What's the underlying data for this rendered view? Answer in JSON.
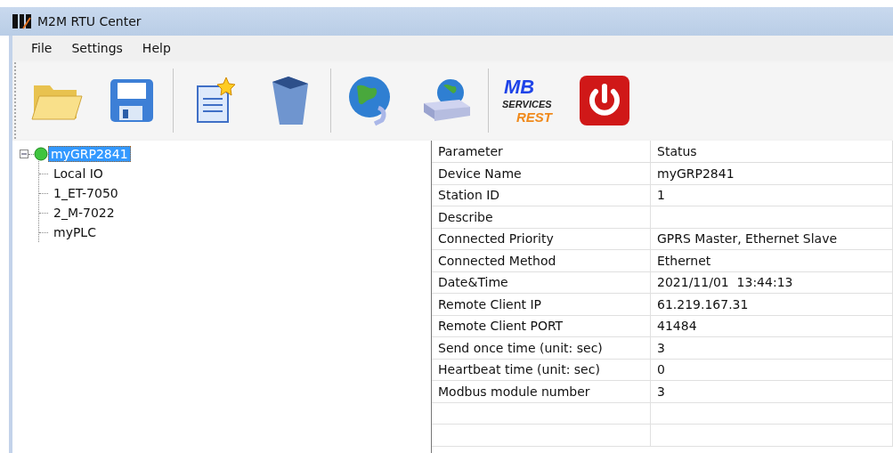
{
  "window": {
    "title": "M2M RTU Center"
  },
  "menu": [
    "File",
    "Settings",
    "Help"
  ],
  "toolbar": [
    {
      "kind": "folder"
    },
    {
      "kind": "floppy"
    },
    {
      "kind": "separator"
    },
    {
      "kind": "document"
    },
    {
      "kind": "bin"
    },
    {
      "kind": "separator"
    },
    {
      "kind": "globe"
    },
    {
      "kind": "server"
    },
    {
      "kind": "separator"
    },
    {
      "kind": "mb",
      "lines": [
        "MB",
        "SERVICES",
        "REST"
      ]
    },
    {
      "kind": "power"
    }
  ],
  "tree": {
    "label": "myGRP2841",
    "selected": true,
    "expanded": true,
    "online": true,
    "children": [
      {
        "label": "Local IO",
        "selected": false
      },
      {
        "label": "1_ET-7050",
        "selected": false
      },
      {
        "label": "2_M-7022",
        "selected": false
      },
      {
        "label": "myPLC",
        "selected": false
      }
    ]
  },
  "table": {
    "columns": [
      "Parameter",
      "Status"
    ],
    "rows": [
      [
        "Device Name",
        "myGRP2841"
      ],
      [
        "Station ID",
        "1"
      ],
      [
        "Describe"
      ],
      [
        "Connected Priority",
        "GPRS Master, Ethernet Slave"
      ],
      [
        "Connected Method",
        "Ethernet"
      ],
      [
        "Date&Time",
        "2021/11/01  13:44:13"
      ],
      [
        "Remote Client IP",
        "61.219.167.31"
      ],
      [
        "Remote Client PORT",
        "41484"
      ],
      [
        "Send once time (unit: sec)",
        "3"
      ],
      [
        "Heartbeat time (unit: sec)",
        "0"
      ],
      [
        "Modbus module number",
        "3"
      ]
    ]
  }
}
